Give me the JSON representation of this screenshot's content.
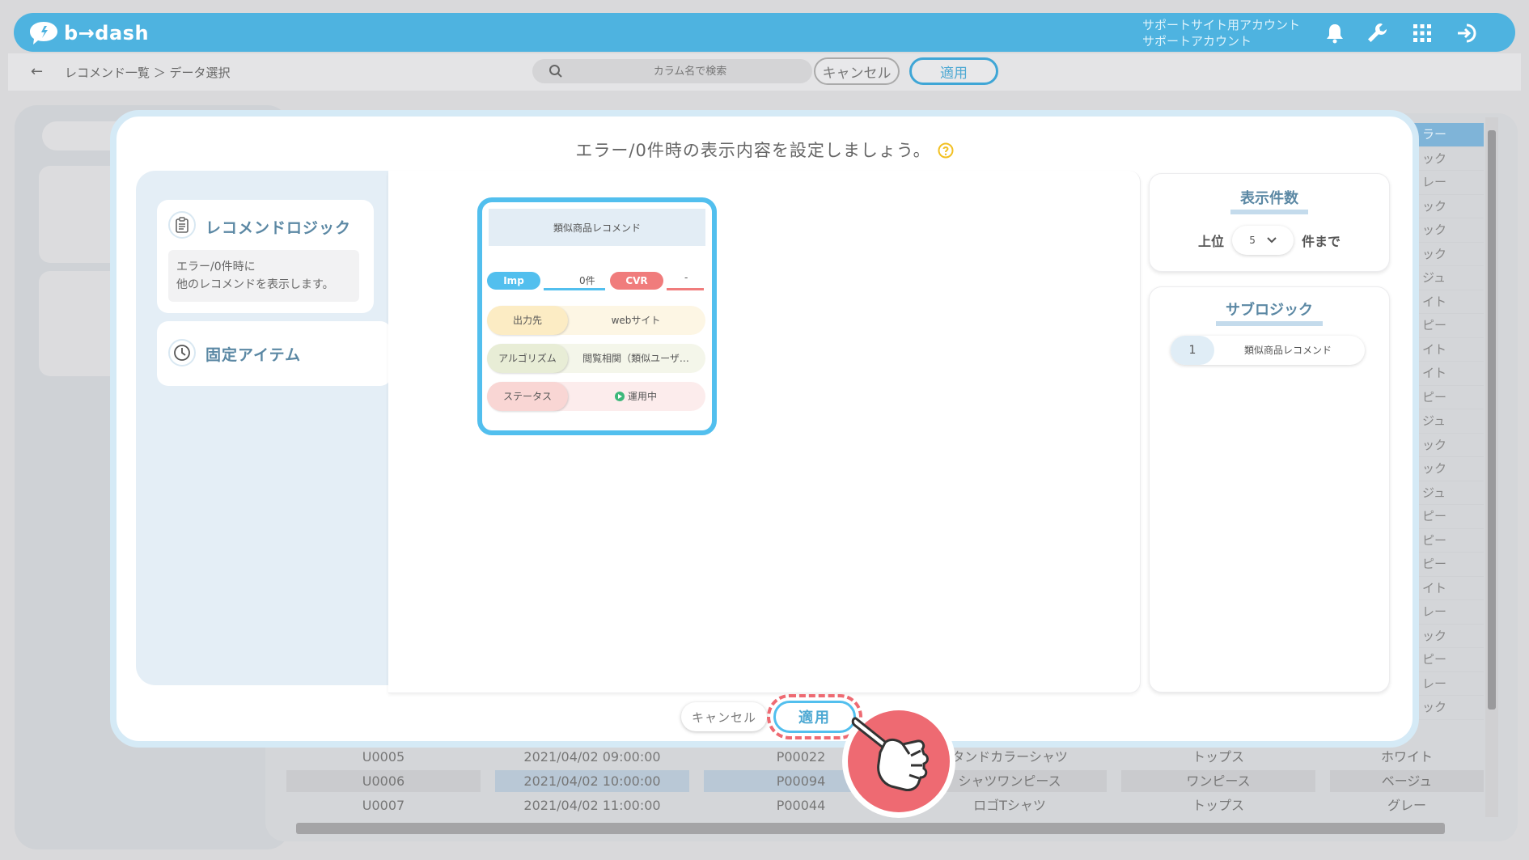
{
  "header": {
    "brand": "b→dash",
    "account_line1": "サポートサイト用アカウント",
    "account_line2": "サポートアカウント",
    "icons": [
      "bell-icon",
      "wrench-icon",
      "grid-icon",
      "logout-icon"
    ]
  },
  "subbar": {
    "breadcrumb": "レコメンド一覧 ＞ データ選択",
    "search_placeholder": "カラム名で検索",
    "cancel_label": "キャンセル",
    "apply_label": "適用"
  },
  "background": {
    "right_column": [
      "ラー",
      "ック",
      "レー",
      "ック",
      "ック",
      "ック",
      "ジュ",
      "イト",
      "ピー",
      "イト",
      "イト",
      "ピー",
      "ジュ",
      "ック",
      "ック",
      "ジュ",
      "ピー",
      "ピー",
      "ピー",
      "イト",
      "レー",
      "ック",
      "ピー",
      "レー",
      "ック"
    ],
    "rows": [
      {
        "user": "U0005",
        "datetime": "2021/04/02 09:00:00",
        "product": "P00022",
        "name": "タンドカラーシャツ",
        "category": "トップス",
        "color": "ホワイト"
      },
      {
        "user": "U0006",
        "datetime": "2021/04/02 10:00:00",
        "product": "P00094",
        "name": "シャツワンピース",
        "category": "ワンピース",
        "color": "ベージュ"
      },
      {
        "user": "U0007",
        "datetime": "2021/04/02 11:00:00",
        "product": "P00044",
        "name": "ロゴTシャツ",
        "category": "トップス",
        "color": "グレー"
      }
    ]
  },
  "modal": {
    "title": "エラー/0件時の表示内容を設定しましょう。",
    "left": {
      "recommend_logic_title": "レコメンドロジック",
      "recommend_logic_desc_1": "エラー/0件時に",
      "recommend_logic_desc_2": "他のレコメンドを表示します。",
      "fixed_item_title": "固定アイテム"
    },
    "logic_card": {
      "name": "類似商品レコメンド",
      "imp_label": "Imp",
      "imp_value": "0件",
      "cvr_label": "CVR",
      "cvr_value": "-",
      "output_label": "出力先",
      "output_value": "webサイト",
      "algorithm_label": "アルゴリズム",
      "algorithm_value": "閲覧相関（類似ユーザ…",
      "status_label": "ステータス",
      "status_value": "運用中"
    },
    "display_count": {
      "title": "表示件数",
      "prefix": "上位",
      "value": "5",
      "suffix": "件まで"
    },
    "sublogic": {
      "title": "サブロジック",
      "items": [
        {
          "num": "1",
          "name": "類似商品レコメンド"
        }
      ]
    },
    "cancel_label": "キャンセル",
    "apply_label": "適用"
  },
  "colors": {
    "accent_blue": "#52bfee",
    "header_blue": "#4eb3e0",
    "highlight_red": "#ee6a72"
  }
}
